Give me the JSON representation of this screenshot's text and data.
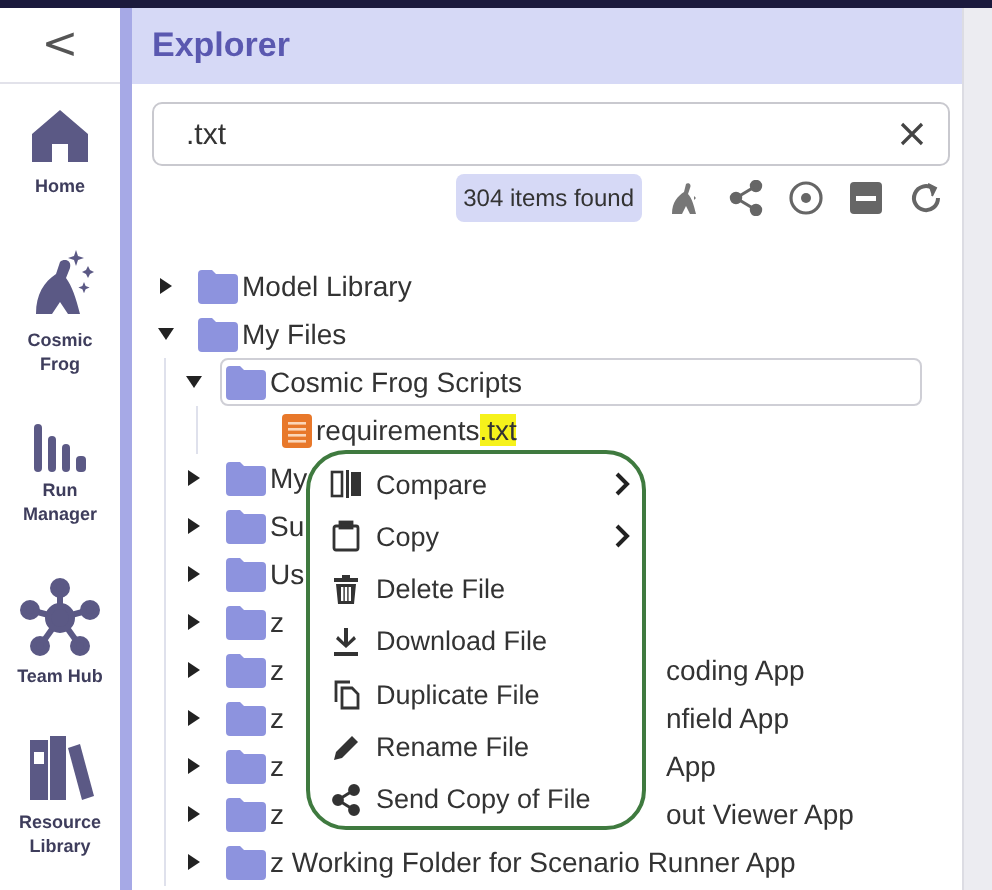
{
  "sidebar": {
    "collapse": "<",
    "items": [
      {
        "label": "Home"
      },
      {
        "label": "Cosmic Frog"
      },
      {
        "label": "Run Manager"
      },
      {
        "label": "Team Hub"
      },
      {
        "label": "Resource Library"
      }
    ]
  },
  "panel": {
    "title": "Explorer"
  },
  "search": {
    "value": ".txt"
  },
  "result_count": "304 items found",
  "tree": [
    {
      "kind": "folder",
      "label": "Model Library",
      "expanded": false,
      "selected": false
    },
    {
      "kind": "folder",
      "label": "My Files",
      "expanded": true,
      "selected": false,
      "children": [
        {
          "kind": "folder",
          "label": "Cosmic Frog Scripts",
          "expanded": true,
          "selected": true,
          "children": [
            {
              "kind": "file",
              "label": "requirements",
              "match": ".txt",
              "selected": false
            }
          ]
        },
        {
          "kind": "folder",
          "label": "My",
          "expanded": false,
          "selected": false
        },
        {
          "kind": "folder",
          "label": "Su",
          "expanded": false,
          "selected": false
        },
        {
          "kind": "folder",
          "label": "Us",
          "expanded": false,
          "selected": false
        },
        {
          "kind": "folder",
          "label": "z",
          "expanded": false,
          "selected": false
        },
        {
          "kind": "folder",
          "label": "z",
          "label_end": "coding App",
          "expanded": false,
          "selected": false
        },
        {
          "kind": "folder",
          "label": "z",
          "label_end": "nfield App",
          "expanded": false,
          "selected": false
        },
        {
          "kind": "folder",
          "label": "z",
          "label_end": "App",
          "expanded": false,
          "selected": false
        },
        {
          "kind": "folder",
          "label": "z",
          "label_end": "out Viewer App",
          "expanded": false,
          "selected": false
        },
        {
          "kind": "folder",
          "label": "z Working Folder for Scenario Runner App",
          "expanded": false,
          "selected": false
        }
      ]
    }
  ],
  "context_menu": [
    {
      "label": "Compare",
      "submenu": true
    },
    {
      "label": "Copy",
      "submenu": true
    },
    {
      "label": "Delete File",
      "submenu": false
    },
    {
      "label": "Download File",
      "submenu": false
    },
    {
      "label": "Duplicate File",
      "submenu": false
    },
    {
      "label": "Rename File",
      "submenu": false
    },
    {
      "label": "Send Copy of File",
      "submenu": false
    }
  ]
}
